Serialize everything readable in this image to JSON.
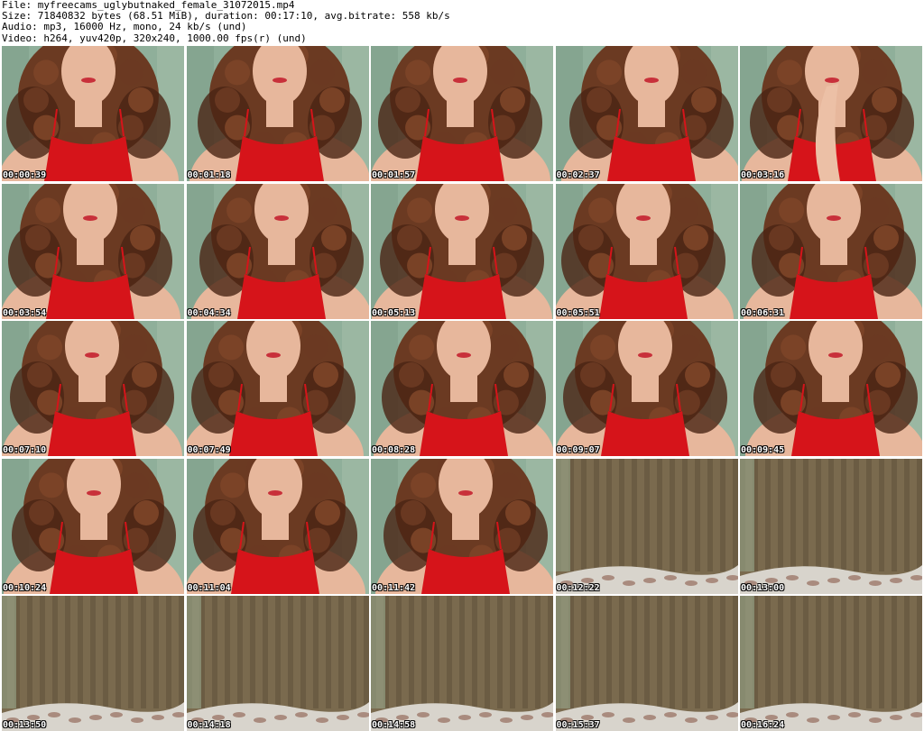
{
  "header": {
    "file_line": "File: myfreecams_uglybutnaked_female_31072015.mp4",
    "size_line": "Size: 71840832 bytes (68.51 MiB), duration: 00:17:10, avg.bitrate: 558 kb/s",
    "audio_line": "Audio: mp3, 16000 Hz, mono, 24 kb/s (und)",
    "video_line": "Video: h264, yuv420p, 320x240, 1000.00 fps(r) (und)"
  },
  "colors": {
    "wall": "#8faf9a",
    "hair": "#6b3a22",
    "hair_dark": "#4a2414",
    "skin": "#e7b79c",
    "dress": "#d6141a",
    "curtain": "#7a6a4e",
    "curtain_dark": "#5e503a",
    "bedding": "#d8d4cc"
  },
  "thumbnails": [
    {
      "time": "00:00:39",
      "scene": "person"
    },
    {
      "time": "00:01:18",
      "scene": "person"
    },
    {
      "time": "00:01:57",
      "scene": "person"
    },
    {
      "time": "00:02:37",
      "scene": "person"
    },
    {
      "time": "00:03:16",
      "scene": "person-hand"
    },
    {
      "time": "00:03:54",
      "scene": "person"
    },
    {
      "time": "00:04:34",
      "scene": "person"
    },
    {
      "time": "00:05:13",
      "scene": "person"
    },
    {
      "time": "00:05:51",
      "scene": "person"
    },
    {
      "time": "00:06:31",
      "scene": "person"
    },
    {
      "time": "00:07:10",
      "scene": "person"
    },
    {
      "time": "00:07:49",
      "scene": "person"
    },
    {
      "time": "00:08:28",
      "scene": "person"
    },
    {
      "time": "00:09:07",
      "scene": "person"
    },
    {
      "time": "00:09:45",
      "scene": "person"
    },
    {
      "time": "00:10:24",
      "scene": "person"
    },
    {
      "time": "00:11:04",
      "scene": "person"
    },
    {
      "time": "00:11:42",
      "scene": "person"
    },
    {
      "time": "00:12:22",
      "scene": "curtain"
    },
    {
      "time": "00:13:00",
      "scene": "curtain"
    },
    {
      "time": "00:13:50",
      "scene": "curtain"
    },
    {
      "time": "00:14:18",
      "scene": "curtain"
    },
    {
      "time": "00:14:58",
      "scene": "curtain"
    },
    {
      "time": "00:15:37",
      "scene": "curtain"
    },
    {
      "time": "00:16:24",
      "scene": "curtain"
    }
  ]
}
